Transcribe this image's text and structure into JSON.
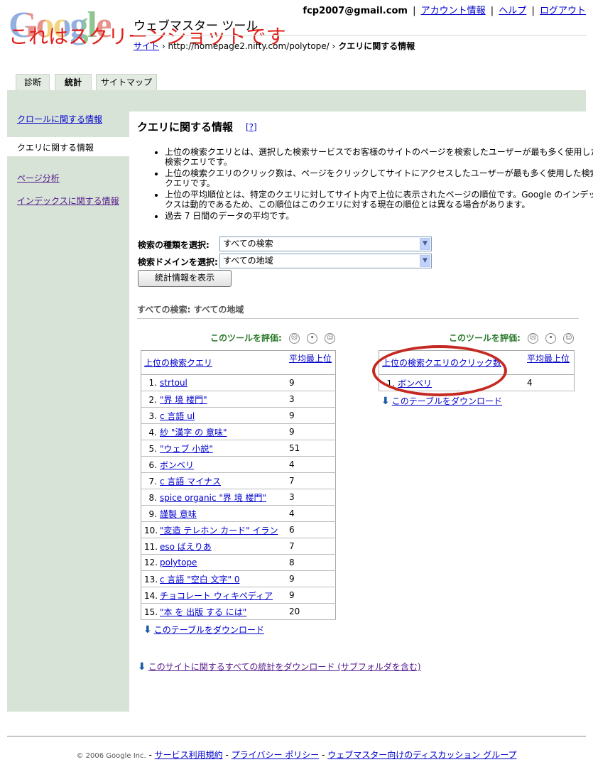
{
  "header": {
    "logo_text": "Google",
    "app_title": "ウェブマスター ツール",
    "overlay_text": "これはスクリーンショットです",
    "account_email": "fcp2007@gmail.com",
    "links": [
      "アカウント情報",
      "ヘルプ",
      "ログアウト"
    ],
    "separator": "|"
  },
  "breadcrumb": {
    "first": "サイト",
    "sep1": "›",
    "site": "http://homepage2.nifty.com/polytope/",
    "sep2": "›",
    "current": "クエリに関する情報"
  },
  "tabs": [
    {
      "label": "診断",
      "active": false
    },
    {
      "label": "統計",
      "active": true
    },
    {
      "label": "サイトマップ",
      "active": false
    }
  ],
  "sidebar": {
    "items": [
      {
        "label": "クロールに関する情報",
        "active": false
      },
      {
        "label": "クエリに関する情報",
        "active": true
      },
      {
        "label": "ページ分析",
        "active": false
      },
      {
        "label": "インデックスに関する情報",
        "active": false
      }
    ]
  },
  "main": {
    "title": "クエリに関する情報",
    "help_link": "[?]",
    "bullets": [
      "上位の検索クエリとは、選択した検索サービスでお客様のサイトのページを検索したユーザーが最も多く使用した検索クエリです。",
      "上位の検索クエリのクリック数は、ページをクリックしてサイトにアクセスしたユーザーが最も多く使用した検索クエリです。",
      "上位の平均順位とは、特定のクエリに対してサイト内で上位に表示されたページの順位です。Google のインデックスは動的であるため、この順位はこのクエリに対する現在の順位とは異なる場合があります。",
      "過去 7 日間のデータの平均です。"
    ],
    "search_type_label": "検索の種類を選択:",
    "search_type_value": "すべての検索",
    "domain_label": "検索ドメインを選択:",
    "domain_value": "すべての地域",
    "show_button": "統計情報を表示",
    "section_title": "すべての検索: すべての地域",
    "rate_label": "このツールを評価:",
    "download_table": "このテーブルをダウンロード",
    "download_all": "このサイトに関するすべての統計をダウンロード (サブフォルダを含む)"
  },
  "top_queries": {
    "col_query": "上位の検索クエリ",
    "col_rank": "平均最上位",
    "rows": [
      {
        "n": "1.",
        "q": "strtoul",
        "r": "9"
      },
      {
        "n": "2.",
        "q": "\"界 境 楼門\"",
        "r": "3"
      },
      {
        "n": "3.",
        "q": "c 言語 ul",
        "r": "9"
      },
      {
        "n": "4.",
        "q": "紗 \"漢字 の 意味\"",
        "r": "9"
      },
      {
        "n": "5.",
        "q": "\"ウェブ 小説\"",
        "r": "51"
      },
      {
        "n": "6.",
        "q": "ボンベリ",
        "r": "4"
      },
      {
        "n": "7.",
        "q": "c 言語 マイナス",
        "r": "7"
      },
      {
        "n": "8.",
        "q": "spice organic \"界 境 楼門\"",
        "r": "3"
      },
      {
        "n": "9.",
        "q": "謹製 意味",
        "r": "4"
      },
      {
        "n": "10.",
        "q": "\"変造 テレホン カード\" イラン",
        "r": "6"
      },
      {
        "n": "11.",
        "q": "eso ばえりあ",
        "r": "7"
      },
      {
        "n": "12.",
        "q": "polytope",
        "r": "8"
      },
      {
        "n": "13.",
        "q": "c 言語 \"空白 文字\" 0",
        "r": "9"
      },
      {
        "n": "14.",
        "q": "チョコレート ウィキペディア",
        "r": "9"
      },
      {
        "n": "15.",
        "q": "\"本 を 出版 する には\"",
        "r": "20"
      }
    ]
  },
  "top_clicks": {
    "col_query": "上位の検索クエリのクリック数",
    "col_rank": "平均最上位",
    "rows": [
      {
        "n": "1.",
        "q": "ボンベリ",
        "r": "4"
      }
    ]
  },
  "footer": {
    "copyright": "© 2006 Google Inc.",
    "links": [
      "サービス利用規約",
      "プライバシー ポリシー",
      "ウェブマスター向けのディスカッション グループ"
    ],
    "separator": "-"
  },
  "colors": {
    "green_band": "#d7e3d7",
    "rate_green": "#2a7a2a",
    "annotation_red": "#c42a22"
  }
}
